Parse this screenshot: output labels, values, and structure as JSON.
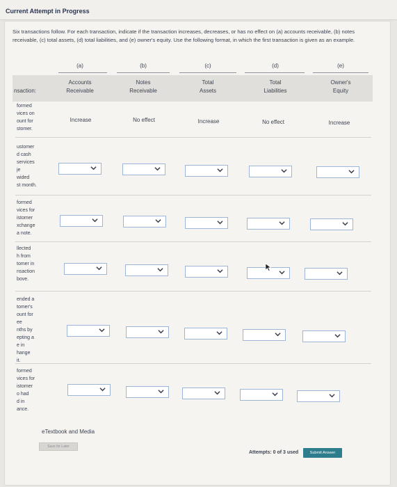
{
  "header": {
    "title": "Current Attempt in Progress"
  },
  "instructions": "Six transactions follow. For each transaction, indicate if the transaction increases, decreases, or has no effect on (a) accounts receivable, (b) notes receivable, (c) total assets, (d) total liabilities, and (e) owner's equity. Use the following format, in which the first transaction is given as an example.",
  "table": {
    "transaction_header": "nsaction:",
    "columns": [
      {
        "letter": "(a)",
        "line1": "Accounts",
        "line2": "Receivable"
      },
      {
        "letter": "(b)",
        "line1": "Notes",
        "line2": "Receivable"
      },
      {
        "letter": "(c)",
        "line1": "Total",
        "line2": "Assets"
      },
      {
        "letter": "(d)",
        "line1": "Total",
        "line2": "Liabilities"
      },
      {
        "letter": "(e)",
        "line1": "Owner's",
        "line2": "Equity"
      }
    ],
    "example_row": {
      "label": [
        "formed",
        "vices on",
        "ount for",
        "stomer."
      ],
      "values": [
        "Increase",
        "No effect",
        "Increase",
        "No effect",
        "Increase"
      ]
    },
    "rows": [
      {
        "label": [
          "ustomer",
          "d cash",
          "services",
          "je",
          "wided",
          "st month."
        ]
      },
      {
        "label": [
          "formed",
          "vices for",
          "istomer",
          "xchange",
          "a note."
        ]
      },
      {
        "label": [
          "llected",
          "h from",
          "",
          "tomer in",
          "nsaction",
          "bove."
        ]
      },
      {
        "label": [
          "ended a",
          "tomer's",
          "ount for",
          "ee",
          "nths by",
          "epting a",
          "e in",
          "hange",
          "it."
        ]
      },
      {
        "label": [
          "formed",
          "vices for",
          "istomer",
          "o had",
          "d in",
          "ance."
        ]
      }
    ]
  },
  "footer": {
    "etextbook": "eTextbook and Media",
    "save_label": "Save for Later",
    "attempts": "Attempts: 0 of 3 used",
    "submit_label": "Submit Answer"
  },
  "colors": {
    "accent": "#2d7d8c",
    "dropdown_border": "#9db5d6"
  },
  "icons": {
    "dropdown": "chevron-down-icon",
    "cursor": "mouse-pointer-icon"
  }
}
